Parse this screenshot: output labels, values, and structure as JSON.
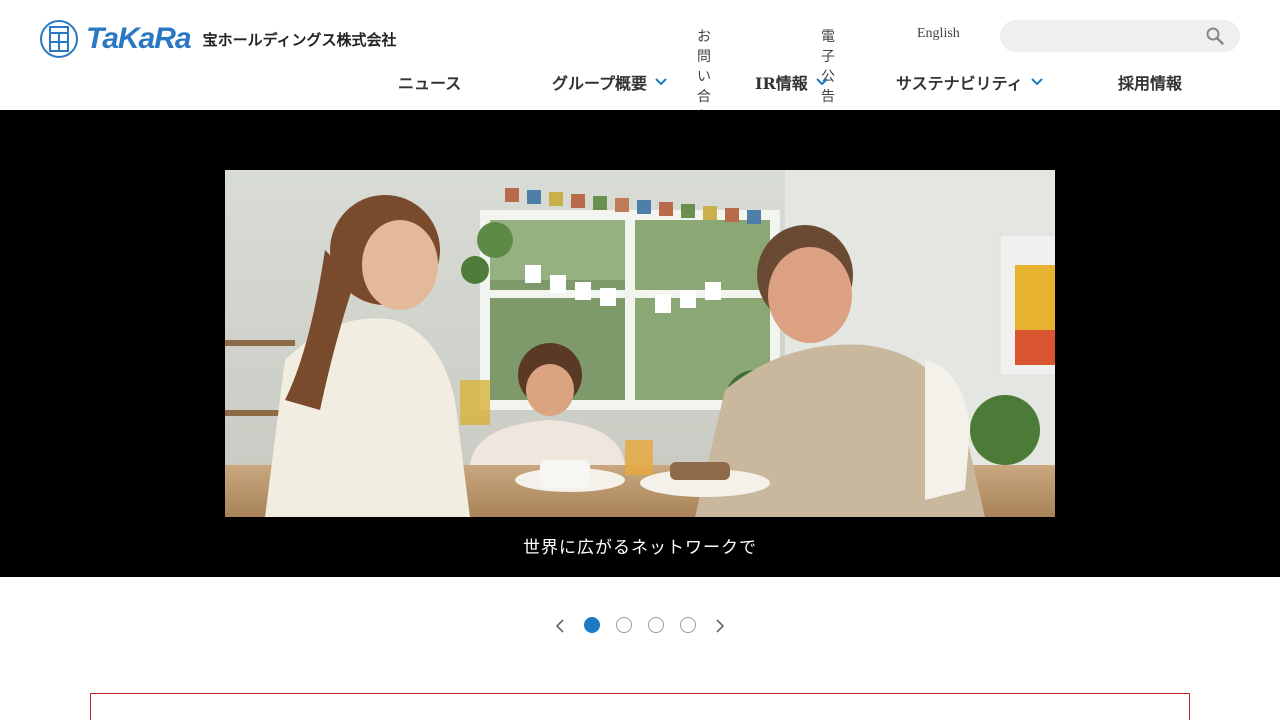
{
  "brand": {
    "wordmark": "TaKaRa",
    "company": "宝ホールディングス株式会社"
  },
  "utility_links": [
    "お問い合わせ",
    "電子公告",
    "English"
  ],
  "search": {
    "placeholder": ""
  },
  "nav": [
    {
      "label": "ニュース",
      "has_dropdown": false
    },
    {
      "label": "グループ概要",
      "has_dropdown": true
    },
    {
      "label": "IR情報",
      "has_dropdown": true
    },
    {
      "label": "サステナビリティ",
      "has_dropdown": true
    },
    {
      "label": "採用情報",
      "has_dropdown": false
    }
  ],
  "hero": {
    "caption": "世界に広がるネットワークで"
  },
  "slider": {
    "slide_count": 4,
    "active_index": 0
  },
  "colors": {
    "brand_blue": "#2a78c4",
    "nav_chevron": "#1a7ac4",
    "dot_active": "#1a7ac4",
    "notice_border": "#c0262c"
  }
}
